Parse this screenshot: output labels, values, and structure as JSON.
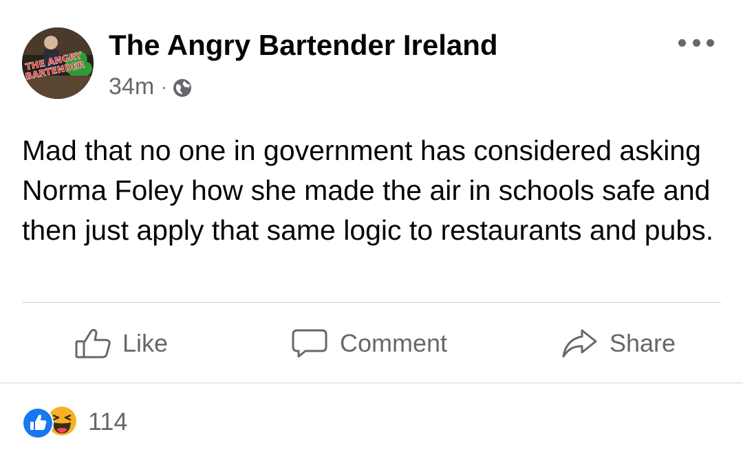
{
  "post": {
    "author": "The Angry Bartender Ireland",
    "avatar_text": [
      "THE ANGRY",
      "BARTENDER"
    ],
    "timestamp": "34m",
    "separator": "·",
    "privacy_icon": "globe-icon",
    "more_icon": "more-options-icon",
    "text": "Mad that no one in government has considered asking Norma Foley how she made the air in schools safe and then just apply that same logic to restaurants and pubs."
  },
  "actions": {
    "like_label": "Like",
    "like_icon": "thumbs-up-icon",
    "comment_label": "Comment",
    "comment_icon": "comment-bubble-icon",
    "share_label": "Share",
    "share_icon": "share-arrow-icon"
  },
  "reactions": {
    "icons": [
      "like-reaction-icon",
      "haha-reaction-icon"
    ],
    "count": "114"
  },
  "colors": {
    "text_primary": "#050505",
    "text_secondary": "#65676b",
    "like_blue": "#1877f2",
    "haha_yellow": "#f7b125",
    "divider": "#ced0d4"
  }
}
